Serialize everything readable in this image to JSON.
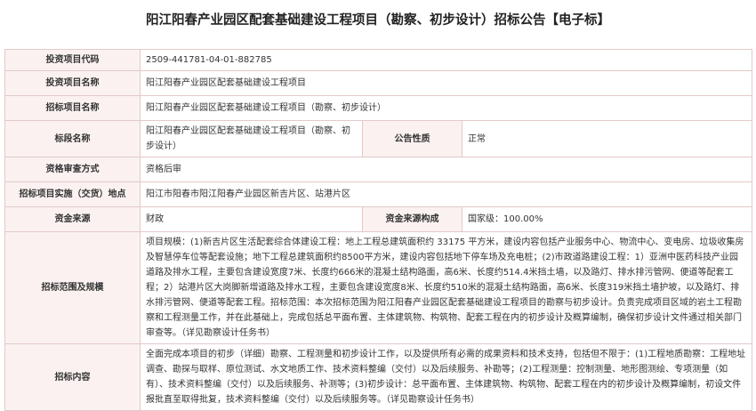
{
  "title": "阳江阳春产业园区配套基础建设工程项目（勘察、初步设计）招标公告【电子标】",
  "rows": {
    "project_code": {
      "label": "投资项目代码",
      "value": "2509-441781-04-01-882785"
    },
    "project_name": {
      "label": "投资项目名称",
      "value": "阳江阳春产业园区配套基础建设工程项目"
    },
    "tender_project_name": {
      "label": "招标项目名称",
      "value": "阳江阳春产业园区配套基础建设工程项目（勘察、初步设计）"
    },
    "section_name": {
      "label": "标段名称",
      "value": "阳江阳春产业园区配套基础建设工程项目（勘察、初步设计）",
      "nature_label": "公告性质",
      "nature_value": "正常"
    },
    "qualification": {
      "label": "资格审查方式",
      "value": "资格后审"
    },
    "location": {
      "label": "招标项目实施（交货）地点",
      "value": "阳江市阳春市阳江阳春产业园区新吉片区、站港片区"
    },
    "funding": {
      "label": "资金来源",
      "value": "财政",
      "composition_label": "资金来源构成",
      "composition_value": "国家级：100.00%"
    },
    "scope": {
      "label": "招标范围及规模",
      "value": "项目规模：(1)新吉片区生活配套综合体建设工程：地上工程总建筑面积约 33175 平方米，建设内容包括产业服务中心、物流中心、变电房、垃圾收集房及智慧停车位等配套设施；地下工程总建筑面积约8500平方米，建设内容包括地下停车场及充电桩；(2)市政道路建设工程：1）亚洲中医药科技产业园道路及排水工程，主要包含建设宽度7米、长度约666米的混凝土结构路面，高6米、长度约514.4米挡土墙，以及路灯、排水排污管网、便道等配套工程；2）站港片区大岗脚新增道路及排水工程，主要包含建设宽度8米、长度约510米的混凝土结构路面，高6米、长度319米挡土墙护坡，以及路灯、排水排污管网、便道等配套工程。招标范围：本次招标范围为阳江阳春产业园区配套基础建设工程项目的勘察与初步设计。负责完成项目区域的岩土工程勘察和工程测量工作，并在此基础上，完成包括总平面布置、主体建筑物、构筑物、配套工程在内的初步设计及概算编制，确保初步设计文件通过相关部门审查等。（详见勘察设计任务书）"
    },
    "content": {
      "label": "招标内容",
      "value": "全面完成本项目的初步（详细）勘察、工程测量和初步设计工作，以及提供所有必需的成果资料和技术支持，包括但不限于：(1)工程地质勘察：工程地址调查、勘探与取样、原位测试、水文地质工作、技术资料整编（交付）以及后续服务、补勘等；(2)工程测量：控制测量、地形图测绘、专项测量（如有）、技术资料整编（交付）以及后续服务、补测等；(3)初步设计：总平面布置、主体建筑物、构筑物、配套工程在内的初步设计及概算编制，初设文件报批直至取得批复，技术资料整编（交付）以及后续服务等。（详见勘察设计任务书）"
    }
  },
  "colors": {
    "label_bg": "#fbf1f1",
    "border": "#e3c9c9",
    "text": "#333333"
  }
}
